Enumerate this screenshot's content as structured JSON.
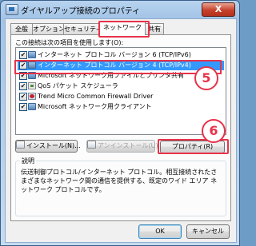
{
  "window": {
    "title": "ダイヤルアップ接続のプロパティ",
    "close_glyph": "X"
  },
  "tabs": [
    {
      "label": "全般"
    },
    {
      "label": "オプション"
    },
    {
      "label": "セキュリティ"
    },
    {
      "label": "ネットワーク",
      "active": true
    },
    {
      "label": "共有"
    }
  ],
  "panel": {
    "components_label": "この接続は次の項目を使用します(O):",
    "items": [
      {
        "label": "インターネット プロトコル バージョン 6 (TCP/IPv6)",
        "checked": true,
        "icon": "network-protocol-icon"
      },
      {
        "label": "インターネット プロトコル バージョン 4 (TCP/IPv4)",
        "checked": true,
        "icon": "network-protocol-icon",
        "selected": true
      },
      {
        "label": "Microsoft ネットワーク用ファイルとプリンタ共有",
        "checked": true,
        "icon": "network-service-icon"
      },
      {
        "label": "QoS パケット スケジューラ",
        "checked": true,
        "icon": "qos-icon"
      },
      {
        "label": "Trend Micro Common Firewall Driver",
        "checked": true,
        "icon": "firewall-icon"
      },
      {
        "label": "Microsoft ネットワーク用クライアント",
        "checked": true,
        "icon": "network-client-icon"
      }
    ],
    "install_label": "インストール(N)...",
    "uninstall_label": "アンインストール(U)",
    "properties_label": "プロパティ(R)",
    "description_legend": "説明",
    "description_text": "伝送制御プロトコル/インターネット プロトコル。相互接続されたさまざまなネットワーク間の通信を提供する、既定のワイド エリア ネットワーク プロトコルです。"
  },
  "annotations": {
    "step5": "5",
    "step6": "6",
    "highlight_color": "#e8334a"
  },
  "footer": {
    "ok_label": "OK",
    "cancel_label": "キャンセル"
  }
}
